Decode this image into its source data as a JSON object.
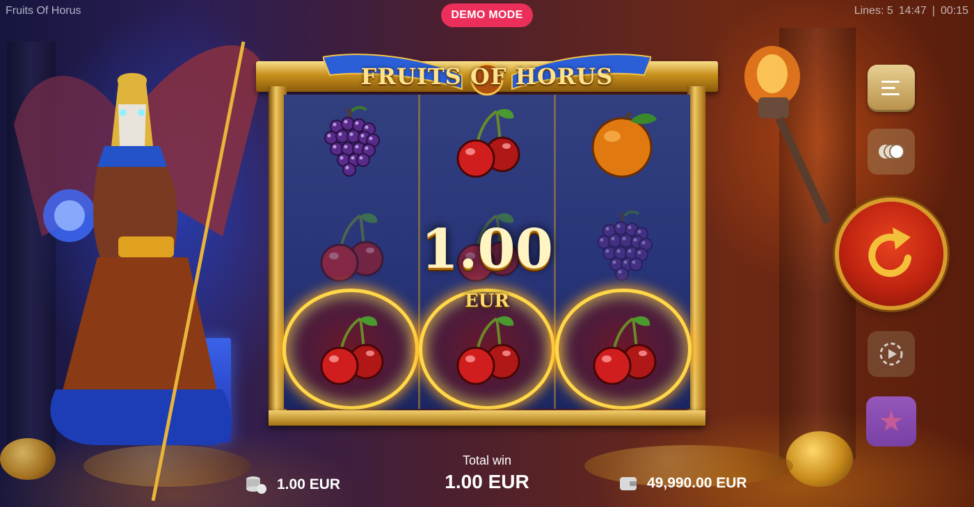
{
  "app": {
    "title": "Fruits Of Horus"
  },
  "badge": {
    "mode": "DEMO MODE"
  },
  "status": {
    "lines": "Lines: 5",
    "clock": "14:47",
    "separator": "|",
    "session": "00:15"
  },
  "game": {
    "logo": "FRUITS OF HORUS",
    "win_amount": "1.00",
    "win_currency": "EUR",
    "reels": [
      [
        "grapes",
        "cherry",
        "cherry"
      ],
      [
        "cherry",
        "cherry",
        "cherry"
      ],
      [
        "orange",
        "grapes",
        "cherry"
      ]
    ],
    "winning_row": 3
  },
  "controls": {
    "menu": "menu-icon",
    "coin_value": "coins-icon",
    "spin": "spin-icon",
    "autoplay": "autoplay-icon",
    "bonus": "star-icon"
  },
  "bottom": {
    "bet_value": "1.00 EUR",
    "total_win_label": "Total win",
    "total_win_value": "1.00 EUR",
    "balance_value": "49,990.00 EUR"
  },
  "colors": {
    "accent": "#ec2f5a",
    "gold": "#f0c860",
    "spin_red": "#c02410",
    "bonus_purple": "#a062d8"
  }
}
